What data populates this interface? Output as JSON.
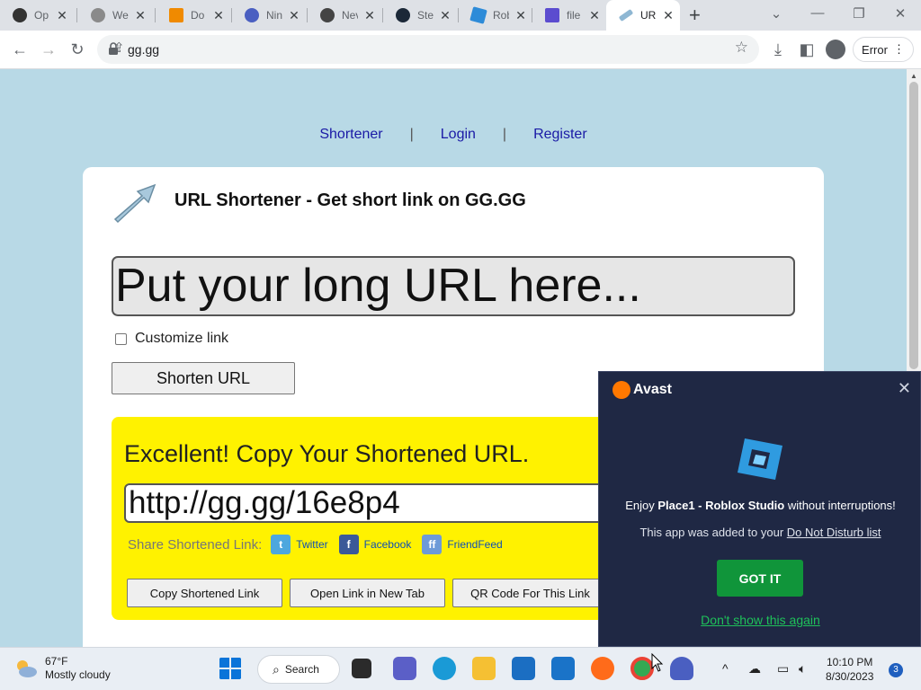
{
  "browser": {
    "tabs": [
      {
        "title": "Op",
        "icon": "obs-icon",
        "color": "#333333"
      },
      {
        "title": "Wel",
        "icon": "globe-icon",
        "color": "#7a7a7a"
      },
      {
        "title": "Do",
        "icon": "vlc-icon",
        "color": "#f08a00"
      },
      {
        "title": "Nin",
        "icon": "ninja-icon",
        "color": "#4a5fc1"
      },
      {
        "title": "Nev",
        "icon": "chrome-icon",
        "color": "#444444"
      },
      {
        "title": "Ste",
        "icon": "steam-icon",
        "color": "#1b2838"
      },
      {
        "title": "Rob",
        "icon": "roblox-studio-icon",
        "color": "#2d8bd8"
      },
      {
        "title": "file",
        "icon": "file-icon",
        "color": "#5b4ccf"
      },
      {
        "title": "URL",
        "icon": "arrow-icon",
        "color": "#8fb7d3",
        "active": true
      }
    ],
    "address": "gg.gg",
    "profile_status": "Error"
  },
  "page": {
    "nav": {
      "shortener": "Shortener",
      "login": "Login",
      "register": "Register",
      "separator": "|"
    },
    "heading": "URL Shortener - Get short link on GG.GG",
    "input_placeholder": "Put your long URL here...",
    "customize_label": "Customize link",
    "shorten_button": "Shorten URL",
    "result": {
      "message": "Excellent! Copy Your Shortened URL.",
      "short_url": "http://gg.gg/16e8p4",
      "share_label": "Share Shortened Link:",
      "share_links": [
        {
          "label": "Twitter",
          "icon": "twitter-icon",
          "color": "#4da7de"
        },
        {
          "label": "Facebook",
          "icon": "facebook-icon",
          "color": "#3b5998"
        },
        {
          "label": "FriendFeed",
          "icon": "friendfeed-icon",
          "color": "#6d9ad8"
        }
      ],
      "buttons": {
        "copy": "Copy Shortened Link",
        "open": "Open Link in New Tab",
        "qr": "QR Code For This Link"
      }
    }
  },
  "avast_popup": {
    "brand": "Avast",
    "line1_prefix": "Enjoy ",
    "line1_app": "Place1 - Roblox Studio",
    "line1_suffix": " without interruptions!",
    "line2_prefix": "This app was added to your ",
    "line2_link": "Do Not Disturb list",
    "got_it": "GOT IT",
    "dont_show": "Don't show this again",
    "colors": {
      "background": "#1f2844",
      "button": "#10953a",
      "link": "#1fc15a",
      "brand": "#ff7800"
    }
  },
  "taskbar": {
    "weather_temp": "67°F",
    "weather_desc": "Mostly cloudy",
    "search_label": "Search",
    "time": "10:10 PM",
    "date": "8/30/2023",
    "notification_count": "3"
  }
}
